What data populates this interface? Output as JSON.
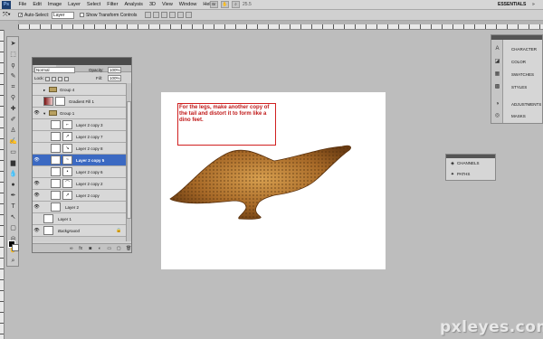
{
  "app": {
    "logo_text": "Ps",
    "workspace": "ESSENTIALS",
    "zoom": "25.5"
  },
  "menu": [
    "File",
    "Edit",
    "Image",
    "Layer",
    "Select",
    "Filter",
    "Analysis",
    "3D",
    "View",
    "Window",
    "Help"
  ],
  "options_bar": {
    "auto_select_label": "Auto-Select:",
    "auto_select_value": "Layer",
    "transform_label": "Show Transform Controls"
  },
  "note": {
    "text": "For the legs, make another copy of the tail and distort it to form like a dino feet."
  },
  "layers_panel": {
    "tab": "LAYERS",
    "blend_mode": "Normal",
    "opacity_label": "Opacity:",
    "opacity": "100%",
    "lock_label": "Lock:",
    "fill_label": "Fill:",
    "fill": "100%",
    "layers": [
      {
        "name": "Group 4",
        "type": "group",
        "visible": false,
        "selected": false
      },
      {
        "name": "Gradient Fill 1",
        "type": "fill",
        "visible": false,
        "selected": false
      },
      {
        "name": "Group 1",
        "type": "group",
        "visible": true,
        "selected": false
      },
      {
        "name": "Layer 2 copy 3",
        "type": "layer",
        "visible": false,
        "selected": false
      },
      {
        "name": "Layer 2 copy 7",
        "type": "layer",
        "visible": false,
        "selected": false
      },
      {
        "name": "Layer 2 copy 8",
        "type": "layer",
        "visible": false,
        "selected": false
      },
      {
        "name": "Layer 2 copy 5",
        "type": "layer",
        "visible": true,
        "selected": true
      },
      {
        "name": "Layer 2 copy 6",
        "type": "layer",
        "visible": false,
        "selected": false
      },
      {
        "name": "Layer 2 copy 2",
        "type": "layer",
        "visible": true,
        "selected": false
      },
      {
        "name": "Layer 2 copy",
        "type": "layer",
        "visible": true,
        "selected": false
      },
      {
        "name": "Layer 2",
        "type": "layer",
        "visible": true,
        "selected": false
      },
      {
        "name": "Layer 1",
        "type": "layer",
        "visible": false,
        "selected": false
      },
      {
        "name": "Background",
        "type": "background",
        "visible": true,
        "selected": false
      }
    ]
  },
  "right_panel": {
    "items": [
      "CHARACTER",
      "COLOR",
      "SWATCHES",
      "STYLES",
      "ADJUSTMENTS",
      "MASKS"
    ],
    "icons": [
      "character-icon",
      "color-icon",
      "swatches-icon",
      "styles-icon",
      "adjustments-icon",
      "masks-icon"
    ]
  },
  "channels_panel": {
    "items": [
      "CHANNELS",
      "PATHS"
    ]
  },
  "watermark": "pxleyes.com",
  "colors": {
    "selected_layer": "#3b69c2",
    "note_border": "#d02020",
    "canvas_bg": "#bdbdbd"
  }
}
